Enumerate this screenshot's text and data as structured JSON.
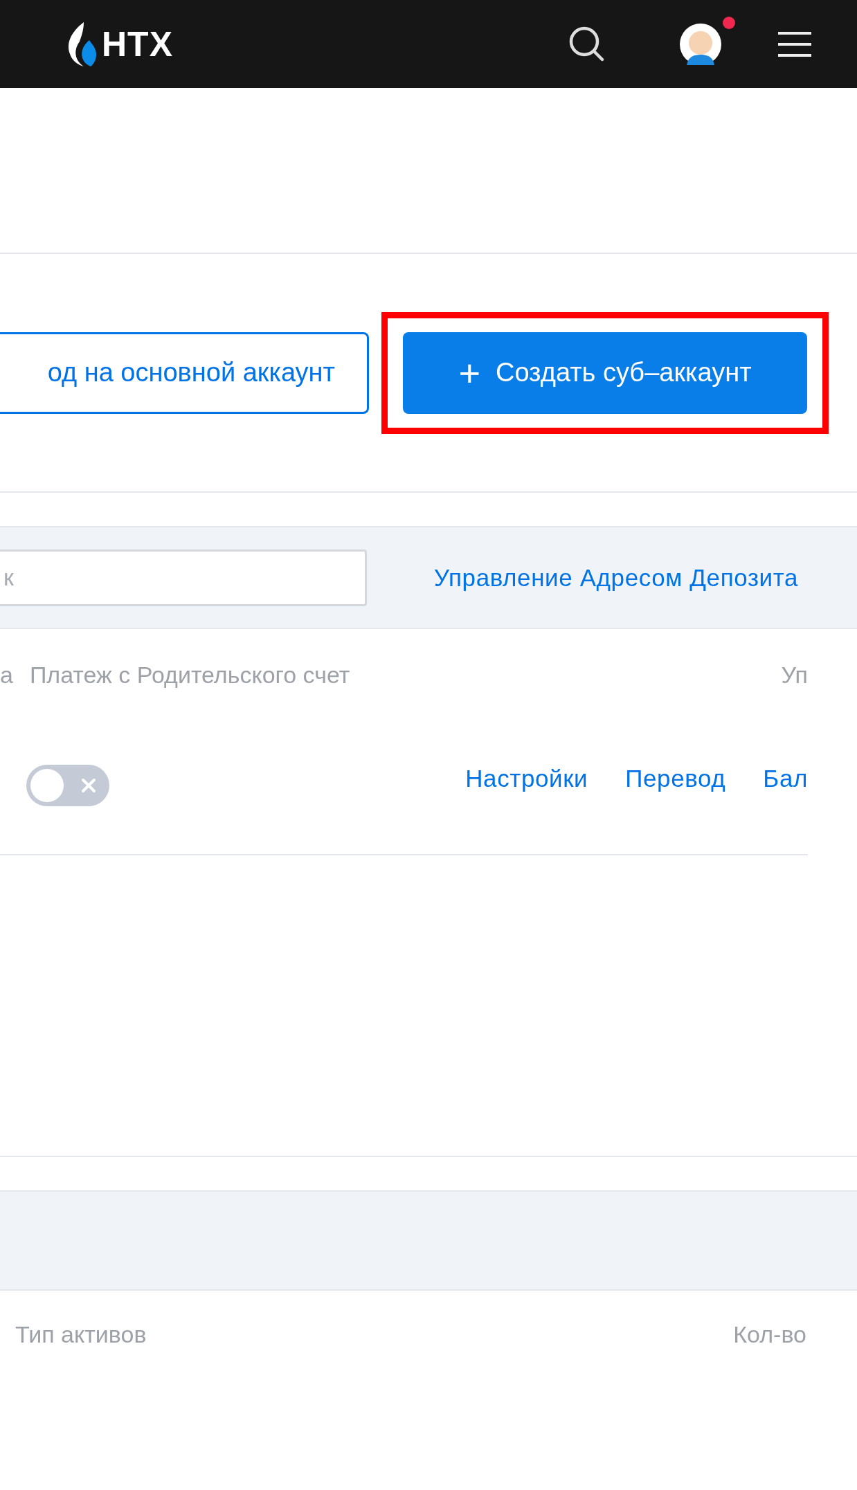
{
  "header": {
    "logo": "HTX",
    "notification": true
  },
  "actions": {
    "secondary_button": "од на основной аккаунт",
    "primary_button": {
      "icon": "+",
      "label": "Создать суб–аккаунт"
    },
    "highlighted": true
  },
  "toolbar": {
    "search": {
      "placeholder": "к"
    },
    "link": "Управление Адресом Депозита"
  },
  "table": {
    "columns": [
      {
        "label": "а"
      },
      {
        "label": "Платеж с Родительского счет"
      },
      {
        "label": "Уп"
      }
    ],
    "rows": [
      {
        "payment_toggle": {
          "on": false
        },
        "links": [
          "Настройки",
          "Перевод",
          "Бал"
        ]
      }
    ]
  },
  "assets": {
    "columns": [
      "Тип активов",
      "Кол-во"
    ]
  }
}
